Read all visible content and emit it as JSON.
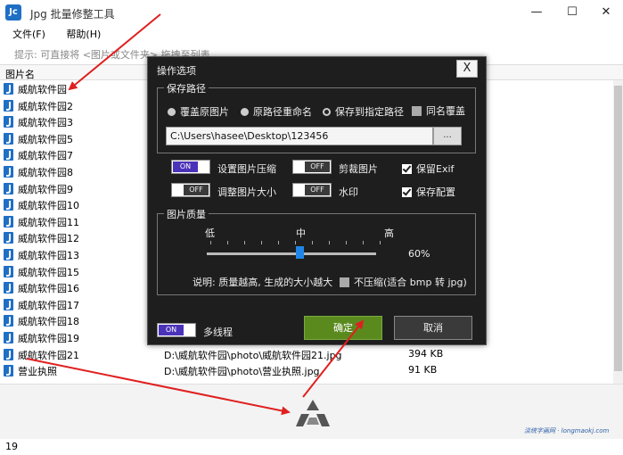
{
  "window": {
    "logo_text": "Jc",
    "title": "Jpg 批量修整工具",
    "minimize": "—",
    "maximize": "☐",
    "close": "✕"
  },
  "menu": [
    {
      "label": "文件(F)"
    },
    {
      "label": "帮助(H)"
    }
  ],
  "hint": "提示: 可直接将 <图片或文件夹> 拖拽至列表",
  "list": {
    "header": "图片名",
    "rows": [
      {
        "name": "威航软件园",
        "path": "",
        "size": ""
      },
      {
        "name": "威航软件园2",
        "path": "",
        "size": ""
      },
      {
        "name": "威航软件园3",
        "path": "",
        "size": ""
      },
      {
        "name": "威航软件园5",
        "path": "",
        "size": ""
      },
      {
        "name": "威航软件园7",
        "path": "",
        "size": ""
      },
      {
        "name": "威航软件园8",
        "path": "",
        "size": ""
      },
      {
        "name": "威航软件园9",
        "path": "",
        "size": ""
      },
      {
        "name": "威航软件园10",
        "path": "",
        "size": ""
      },
      {
        "name": "威航软件园11",
        "path": "",
        "size": ""
      },
      {
        "name": "威航软件园12",
        "path": "",
        "size": ""
      },
      {
        "name": "威航软件园13",
        "path": "",
        "size": ""
      },
      {
        "name": "威航软件园15",
        "path": "",
        "size": ""
      },
      {
        "name": "威航软件园16",
        "path": "",
        "size": ""
      },
      {
        "name": "威航软件园17",
        "path": "",
        "size": ""
      },
      {
        "name": "威航软件园18",
        "path": "",
        "size": ""
      },
      {
        "name": "威航软件园19",
        "path": "",
        "size": ""
      },
      {
        "name": "威航软件园21",
        "path": "D:\\威航软件园\\photo\\威航软件园21.jpg",
        "size": "394 KB"
      },
      {
        "name": "营业执照",
        "path": "D:\\威航软件园\\photo\\营业执照.jpg",
        "size": "91 KB"
      }
    ]
  },
  "status": {
    "count": "19"
  },
  "watermark": "淡统字画网 · longmaokj.com",
  "dialog": {
    "title": "操作选项",
    "close": "X",
    "save_path": {
      "label": "保存路径",
      "options": [
        {
          "label": "覆盖原图片",
          "selected": false
        },
        {
          "label": "原路径重命名",
          "selected": false
        },
        {
          "label": "保存到指定路径",
          "selected": true
        }
      ],
      "same_name_overwrite": {
        "label": "同名覆盖",
        "checked": false
      },
      "path_value": "C:\\Users\\hasee\\Desktop\\123456",
      "browse": "..."
    },
    "options": {
      "compress": {
        "label": "设置图片压缩",
        "state": "ON"
      },
      "crop": {
        "label": "剪裁图片",
        "state": "OFF"
      },
      "keep_exif": {
        "label": "保留Exif",
        "checked": true
      },
      "resize": {
        "label": "调整图片大小",
        "state": "OFF"
      },
      "watermark": {
        "label": "水印",
        "state": "OFF"
      },
      "save_config": {
        "label": "保存配置",
        "checked": true
      }
    },
    "quality": {
      "label": "图片质量",
      "low": "低",
      "mid": "中",
      "high": "高",
      "value": 0.6,
      "value_text": "60%",
      "note": "说明: 质量越高, 生成的大小越大",
      "no_compress": {
        "label": "不压缩(适合 bmp 转 jpg)",
        "checked": false
      }
    },
    "multithread": {
      "label": "多线程",
      "state": "ON"
    },
    "ok": "确定",
    "cancel": "取消"
  },
  "colors": {
    "accent_blue": "#1f6fc5",
    "toggle_on": "#4b32b8",
    "ok_green": "#5a8a1e",
    "arrow_red": "#e02020",
    "slider_thumb": "#1f86e8"
  }
}
